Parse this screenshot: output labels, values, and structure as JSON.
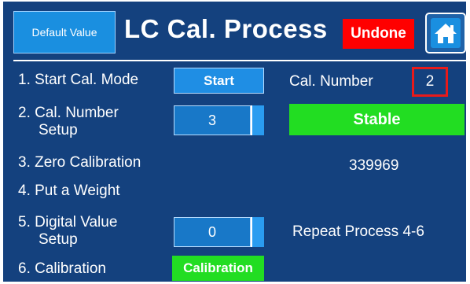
{
  "header": {
    "default_value_label": "Default Value",
    "title": "LC Cal. Process",
    "status": "Undone",
    "home_icon": "home-icon"
  },
  "steps": {
    "step1_label": "1. Start Cal. Mode",
    "start_button": "Start",
    "step2_label_line1": "2. Cal. Number",
    "step2_label_line2": "Setup",
    "cal_number_setup_value": "3",
    "step3_label": "3. Zero Calibration",
    "step4_label": "4. Put a Weight",
    "step5_label_line1": "5. Digital Value",
    "step5_label_line2": "Setup",
    "digital_value_setup_value": "0",
    "step6_label": "6. Calibration",
    "calibration_button": "Calibration"
  },
  "status_panel": {
    "cal_number_label": "Cal. Number",
    "cal_number_value": "2",
    "stable_label": "Stable",
    "reading": "339969",
    "repeat_note": "Repeat Process 4-6"
  },
  "colors": {
    "panel_bg": "#14417e",
    "accent_blue": "#1f8ee4",
    "status_red": "#ff0000",
    "status_green": "#22dd22",
    "highlight_red": "#e81a1a"
  }
}
